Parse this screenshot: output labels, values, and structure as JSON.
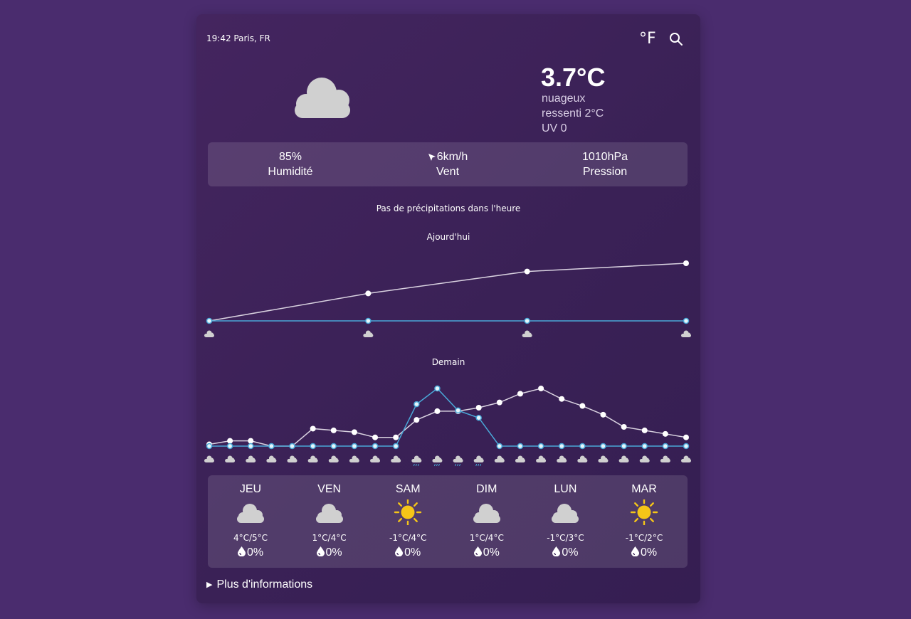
{
  "header": {
    "location_time": "19:42 Paris, FR",
    "unit_toggle": "°F",
    "search_icon": "search-icon"
  },
  "current": {
    "icon": "cloud-icon",
    "temperature": "3.7°C",
    "condition": "nuageux",
    "feels_like": "ressenti 2°C",
    "uv": "UV 0"
  },
  "stats": {
    "humidity_value": "85%",
    "humidity_label": "Humidité",
    "wind_value": "6km/h",
    "wind_label": "Vent",
    "wind_icon": "wind-direction-arrow-icon",
    "pressure_value": "1010hPa",
    "pressure_label": "Pression"
  },
  "precip_note": "Pas de précipitations dans l'heure",
  "colors": {
    "background": "#4a2c6e",
    "temperature_line": "#d9d2e0",
    "precip_line": "#4aa8d8",
    "point_fill": "#ffffff",
    "sun": "#f5c518",
    "cloud": "#d0d0d0"
  },
  "chart_data": [
    {
      "type": "line",
      "title": "Ajourd'hui",
      "series": [
        {
          "key": "temperature",
          "values": [
            2.3,
            3.3,
            4.1,
            4.4
          ]
        },
        {
          "key": "precipitation",
          "values": [
            0,
            0,
            0,
            0
          ]
        }
      ],
      "icons": [
        "cloud-icon",
        "cloud-icon",
        "cloud-icon",
        "cloud-icon"
      ]
    },
    {
      "type": "line",
      "title": "Demain",
      "series": [
        {
          "key": "temperature",
          "values": [
            1.1,
            1.3,
            1.3,
            1.0,
            1.0,
            2.0,
            1.9,
            1.8,
            1.5,
            1.5,
            2.5,
            3.0,
            3.0,
            3.2,
            3.5,
            4.0,
            4.3,
            3.7,
            3.3,
            2.8,
            2.1,
            1.9,
            1.7,
            1.5
          ]
        },
        {
          "key": "precipitation",
          "values": [
            0,
            0,
            0,
            0,
            0,
            0,
            0,
            0,
            0,
            0,
            40,
            55,
            34,
            27,
            0,
            0,
            0,
            0,
            0,
            0,
            0,
            0,
            0,
            0
          ]
        }
      ],
      "icons": [
        "cloud-icon",
        "cloud-icon",
        "cloud-icon",
        "cloud-icon",
        "cloud-icon",
        "cloud-icon",
        "cloud-icon",
        "cloud-icon",
        "cloud-icon",
        "cloud-icon",
        "rain-cloud-icon",
        "rain-cloud-icon",
        "rain-cloud-icon",
        "rain-cloud-icon",
        "cloud-icon",
        "cloud-icon",
        "cloud-icon",
        "cloud-icon",
        "cloud-icon",
        "cloud-icon",
        "cloud-icon",
        "cloud-icon",
        "cloud-icon",
        "cloud-icon"
      ]
    }
  ],
  "forecast": [
    {
      "day": "JEU",
      "icon": "cloud-icon",
      "temps": "4°C/5°C",
      "rain": "0%"
    },
    {
      "day": "VEN",
      "icon": "cloud-icon",
      "temps": "1°C/4°C",
      "rain": "0%"
    },
    {
      "day": "SAM",
      "icon": "sun-icon",
      "temps": "-1°C/4°C",
      "rain": "0%"
    },
    {
      "day": "DIM",
      "icon": "cloud-icon",
      "temps": "1°C/4°C",
      "rain": "0%"
    },
    {
      "day": "LUN",
      "icon": "cloud-icon",
      "temps": "-1°C/3°C",
      "rain": "0%"
    },
    {
      "day": "MAR",
      "icon": "sun-icon",
      "temps": "-1°C/2°C",
      "rain": "0%"
    }
  ],
  "more_info": "Plus d'informations"
}
